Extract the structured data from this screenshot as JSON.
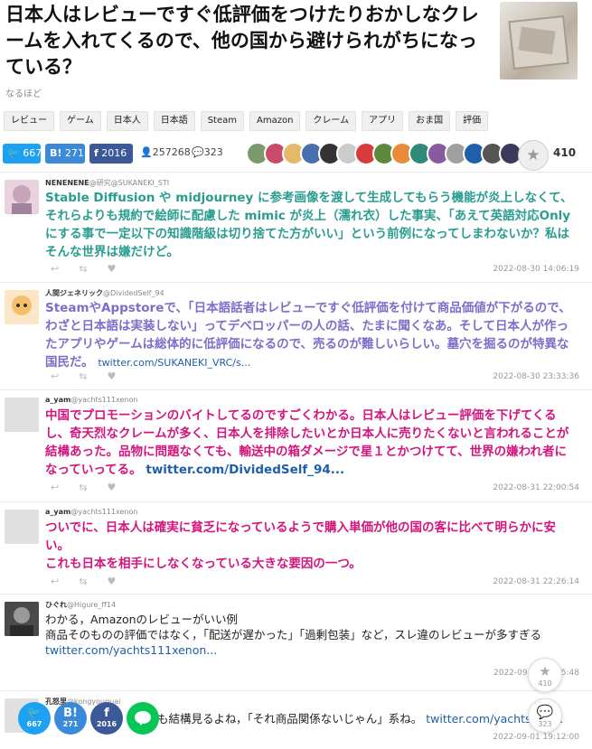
{
  "article": {
    "title": "日本人はレビューですぐ低評価をつけたりおかしなクレームを入れてくるので、他の国から避けられがちになっている？",
    "subtitle": "なるほど"
  },
  "tags": [
    "レビュー",
    "ゲーム",
    "日本人",
    "日本語",
    "Steam",
    "Amazon",
    "クレーム",
    "アプリ",
    "おま国",
    "評価"
  ],
  "share": {
    "twitter_count": "667",
    "hatena_label": "B!",
    "hatena_count": "271",
    "facebook_label": "f",
    "facebook_count": "2016",
    "views": "257268",
    "comments": "323",
    "stars": "410"
  },
  "comments": [
    {
      "name": "NENENENE",
      "handle": "@研究@SUKANEKI_STI",
      "text": "Stable Diffusion や midjourney に参考画像を渡して生成してもらう機能が炎上しなくて、それらよりも規約で絵師に配慮した mimic が炎上（濡れ衣）した事実、「あえて英語対応Onlyにする事で一定以下の知識階級は切り捨てた方がいい」という前例になってしまわないか？私はそんな世界は嫌だけど。",
      "link": "",
      "time": "2022-08-30 14:06:19",
      "color": "#2a9d8f"
    },
    {
      "name": "人間ジェネリック",
      "handle": "@DividedSelf_94",
      "text": "SteamやAppstoreで、「日本語話者はレビューですぐ低評価を付けて商品価値が下がるので、わざと日本語は実装しない」ってデベロッパーの人の話、たまに聞くなあ。そして日本人が作ったアプリやゲームは総体的に低評価になるので、売るのが難しいらしい。墓穴を掘るのが特異な国民だ。",
      "link": "twitter.com/SUKANEKI_VRC/s...",
      "time": "2022-08-30 23:33:36",
      "color": "#7b6fc9"
    },
    {
      "name": "a_yam",
      "handle": "@yachts111xenon",
      "text": "中国でプロモーションのバイトしてるのですごくわかる。日本人はレビュー評価を下げてくるし、奇天烈なクレームが多く、日本人を排除したいとか日本人に売りたくないと言われることが結構あった。品物に問題なくても、輸送中の箱ダメージで星１とかつけてて、世界の嫌われ者になっていってる。",
      "link": "twitter.com/DividedSelf_94...",
      "time": "2022-08-31 22:00:54",
      "color": "#d4157e"
    },
    {
      "name": "a_yam",
      "handle": "@yachts111xenon",
      "text": "ついでに、日本人は確実に貧乏になっているようで購入単価が他の国の客に比べて明らかに安い。\nこれも日本を相手にしなくなっている大きな要因の一つ。",
      "link": "",
      "time": "2022-08-31 22:26:14",
      "color": "#d4157e"
    },
    {
      "name": "ひぐれ",
      "handle": "@Higure_ff14",
      "text": "わかる，Amazonのレビューがいい例\n商品そのものの評価ではなく，「配送が遅かった」「過剰包装」など，スレ違のレビューが多すぎる",
      "link": "twitter.com/yachts111xenon...",
      "time": "2022-09-0",
      "time_tail": "5:48",
      "color": "#222"
    },
    {
      "name": "孔怒里",
      "handle": "@kongyouguai",
      "text": "も結構見るよね，「それ商品関係ないじゃん」系ね。",
      "link": "twitter.com/yachts111...",
      "time": "2022-09-01 19:12:00",
      "color": "#222"
    }
  ],
  "float": {
    "twitter_count": "667",
    "hatena_label": "B!",
    "hatena_count": "271",
    "facebook_label": "f",
    "facebook_count": "2016",
    "star_count": "410",
    "comment_count": "323"
  },
  "icons": [
    "twitter-icon",
    "hatena-icon",
    "facebook-icon",
    "person-icon",
    "comment-icon",
    "star-icon",
    "reply-icon",
    "retweet-icon",
    "like-icon",
    "line-icon"
  ],
  "colors": {
    "twitter": "#1da1f2",
    "hatena": "#3b8ad9",
    "facebook": "#3b5998",
    "line": "#06c755",
    "teal_text": "#2a9d8f",
    "purple_text": "#7b6fc9",
    "magenta_text": "#d4157e",
    "link": "#1d5fa8"
  }
}
